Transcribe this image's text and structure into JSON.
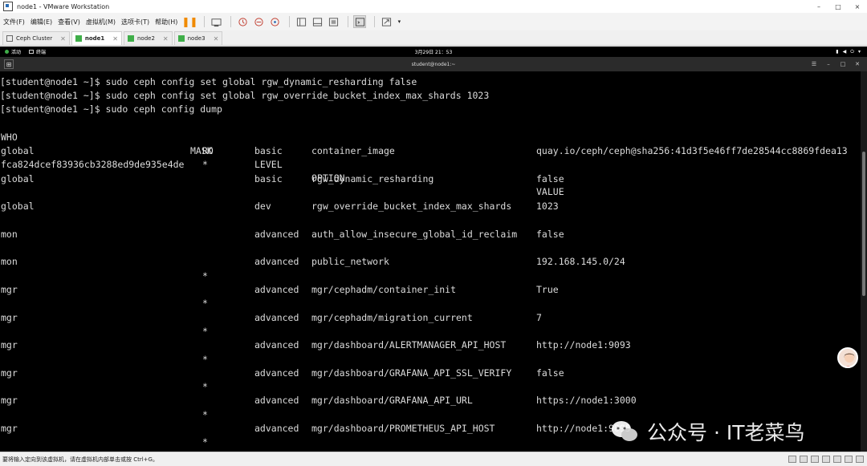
{
  "window": {
    "title": "node1 - VMware Workstation",
    "controls": [
      "–",
      "□",
      "×"
    ]
  },
  "menu": [
    "文件(F)",
    "编辑(E)",
    "查看(V)",
    "虚拟机(M)",
    "选项卡(T)",
    "帮助(H)"
  ],
  "tabs": [
    {
      "label": "Ceph Cluster",
      "active": false
    },
    {
      "label": "node1",
      "active": true
    },
    {
      "label": "node2",
      "active": false
    },
    {
      "label": "node3",
      "active": false
    }
  ],
  "gnome": {
    "activities": "活动",
    "terminal": "终端",
    "clock": "3月29日 21：53"
  },
  "terminal_title": "student@node1:~",
  "commands": [
    "[student@node1 ~]$ sudo ceph config set global rgw_dynamic_resharding false",
    "[student@node1 ~]$ sudo ceph config set global rgw_override_bucket_index_max_shards 1023",
    "[student@node1 ~]$ sudo ceph config dump"
  ],
  "table": {
    "headers": {
      "who": "WHO",
      "mask": "MASK",
      "level": "LEVEL",
      "option": "OPTION",
      "value": "VALUE",
      "ro": "RO"
    },
    "rows": [
      {
        "who": "global",
        "level": "basic",
        "option": "container_image",
        "value": "quay.io/ceph/ceph@sha256:41d3f5e46ff7de28544cc8869fdea13",
        "wrap": "fca824dcef83936cb3288ed9de935e4de",
        "ro": "*"
      },
      {
        "who": "global",
        "level": "basic",
        "option": "rgw_dynamic_resharding",
        "value": "false",
        "wrap": "",
        "ro": ""
      },
      {
        "who": "global",
        "level": "dev",
        "option": "rgw_override_bucket_index_max_shards",
        "value": "1023",
        "wrap": "",
        "ro": ""
      },
      {
        "who": "mon",
        "level": "advanced",
        "option": "auth_allow_insecure_global_id_reclaim",
        "value": "false",
        "wrap": "",
        "ro": ""
      },
      {
        "who": "mon",
        "level": "advanced",
        "option": "public_network",
        "value": "192.168.145.0/24",
        "wrap": "",
        "ro": "*"
      },
      {
        "who": "mgr",
        "level": "advanced",
        "option": "mgr/cephadm/container_init",
        "value": "True",
        "wrap": "",
        "ro": "*"
      },
      {
        "who": "mgr",
        "level": "advanced",
        "option": "mgr/cephadm/migration_current",
        "value": "7",
        "wrap": "",
        "ro": "*"
      },
      {
        "who": "mgr",
        "level": "advanced",
        "option": "mgr/dashboard/ALERTMANAGER_API_HOST",
        "value": "http://node1:9093",
        "wrap": "",
        "ro": "*"
      },
      {
        "who": "mgr",
        "level": "advanced",
        "option": "mgr/dashboard/GRAFANA_API_SSL_VERIFY",
        "value": "false",
        "wrap": "",
        "ro": "*"
      },
      {
        "who": "mgr",
        "level": "advanced",
        "option": "mgr/dashboard/GRAFANA_API_URL",
        "value": "https://node1:3000",
        "wrap": "",
        "ro": "*"
      },
      {
        "who": "mgr",
        "level": "advanced",
        "option": "mgr/dashboard/PROMETHEUS_API_HOST",
        "value": "http://node1:9095",
        "wrap": "",
        "ro": "*"
      }
    ]
  },
  "statusbar": "要将输入定向到该虚拟机，请在虚拟机内部单击或按 Ctrl+G。",
  "watermark": "公众号 · IT老菜鸟",
  "colors": {
    "terminal_bg": "#000000",
    "terminal_fg": "#dcdcdc",
    "pause": "#f08a00"
  }
}
